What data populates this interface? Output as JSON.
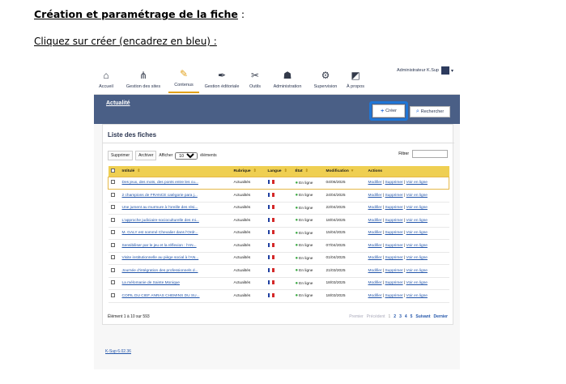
{
  "doc": {
    "heading": "Création et paramétrage de la fiche",
    "heading_suffix": " :",
    "instruction": "Cliquez sur créer (encadrez en bleu) :"
  },
  "nav": {
    "items": [
      {
        "label": "Accueil",
        "icon": "home-icon"
      },
      {
        "label": "Gestion des sites",
        "icon": "sitemap-icon"
      },
      {
        "label": "Contenus",
        "icon": "edit-icon"
      },
      {
        "label": "Gestion éditoriale",
        "icon": "pen-icon"
      },
      {
        "label": "Outils",
        "icon": "tools-icon"
      },
      {
        "label": "Administration",
        "icon": "users-icon"
      },
      {
        "label": "Supervision",
        "icon": "gears-icon"
      },
      {
        "label": "À propos",
        "icon": "about-icon"
      }
    ],
    "active_index": 2
  },
  "user": {
    "name": "Administrateur K.Sup"
  },
  "page": {
    "section_title": "Actualité",
    "create_label": "Créer",
    "search_label": "Rechercher"
  },
  "list": {
    "title": "Liste des fiches",
    "delete_label": "Supprimer",
    "archive_label": "Archiver",
    "show_label": "Afficher",
    "page_size": "10",
    "elements_label": "éléments",
    "filter_label": "Filtrer",
    "columns": [
      "Intitulé",
      "Rubrique",
      "Langue",
      "État",
      "Modification",
      "Actions"
    ],
    "rows": [
      {
        "title": "Des jeux, des mots, des ponts entre les cu...",
        "rubric": "Actualités",
        "state": "En ligne",
        "date": "04/06/2025"
      },
      {
        "title": "2 champions de FRANCE catégorie para j...",
        "rubric": "Actualités",
        "state": "En ligne",
        "date": "24/04/2025"
      },
      {
        "title": "Une jument au murmure à l'oreille des rési...",
        "rubric": "Actualités",
        "state": "En ligne",
        "date": "22/04/2025"
      },
      {
        "title": "L'approche judiciaire-socioculturelle des mi...",
        "rubric": "Actualités",
        "state": "En ligne",
        "date": "18/04/2025"
      },
      {
        "title": "M. GALY est nommé Chevalier dans l'Ordr...",
        "rubric": "Actualités",
        "state": "En ligne",
        "date": "15/04/2025"
      },
      {
        "title": "Sensibiliser par le jeu et la réflexion : l'AN...",
        "rubric": "Actualités",
        "state": "En ligne",
        "date": "07/04/2025"
      },
      {
        "title": "Visite institutionnelle au piège social à l'AN...",
        "rubric": "Actualités",
        "state": "En ligne",
        "date": "01/04/2025"
      },
      {
        "title": "Journée d'intégration des professionnels d...",
        "rubric": "Actualités",
        "state": "En ligne",
        "date": "21/03/2025"
      },
      {
        "title": "La mélomanie de Sainte Monique",
        "rubric": "Actualités",
        "state": "En ligne",
        "date": "18/03/2025"
      },
      {
        "title": "COPIL DU CIEF ANRAS CHEMINS DU SU...",
        "rubric": "Actualités",
        "state": "En ligne",
        "date": "18/03/2025"
      }
    ],
    "actions": {
      "modify": "Modifier",
      "delete": "Supprimer",
      "view": "Voir en ligne"
    },
    "summary": "Élément 1 à 10 sur 593",
    "pager": {
      "first": "Premier",
      "prev": "Précédent",
      "pages": [
        "1",
        "2",
        "3",
        "4",
        "5"
      ],
      "next": "Suivant",
      "last": "Dernier"
    }
  },
  "footer": {
    "version": "K-Sup 6.02.36"
  },
  "colors": {
    "header_blue": "#4a5f86",
    "highlight_blue": "#1f76d6",
    "table_header": "#efcf52",
    "status_green": "#3aa843",
    "flag": [
      "#1f3fa0",
      "#ffffff",
      "#d42828"
    ]
  }
}
